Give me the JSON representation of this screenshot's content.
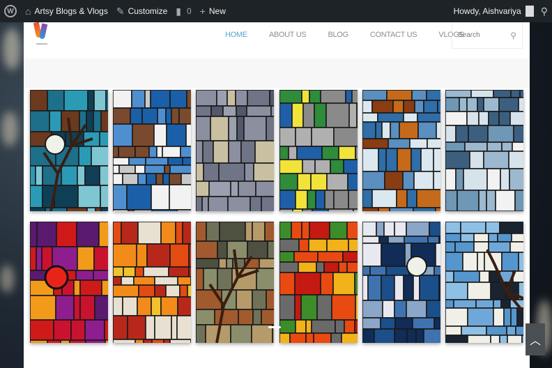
{
  "adminbar": {
    "site_name": "Artsy Blogs & Vlogs",
    "customize_label": "Customize",
    "comments_count": "0",
    "new_label": "New",
    "greeting": "Howdy, Aishvariya"
  },
  "nav": {
    "items": [
      "HOME",
      "ABOUT US",
      "BLOG",
      "CONTACT US",
      "VLOGS"
    ],
    "active": "HOME"
  },
  "search": {
    "placeholder": "Search"
  },
  "gallery": {
    "tiles": [
      {
        "name": "stained-glass-moon-tree-teal",
        "palette": [
          "#1d6f8a",
          "#2a9ab5",
          "#0f3f57",
          "#7fc6d3",
          "#6b3a1e"
        ]
      },
      {
        "name": "stained-glass-blue-white-blocks",
        "palette": [
          "#f2f2f2",
          "#1b5fa8",
          "#c9c9c9",
          "#7a4a2e",
          "#4f8fd0"
        ]
      },
      {
        "name": "stained-glass-grey-grid",
        "palette": [
          "#6f7586",
          "#8b8fa0",
          "#53586a",
          "#9aa0af",
          "#c8c0a0"
        ]
      },
      {
        "name": "stained-glass-green-yellow-blocks",
        "palette": [
          "#8a8a8a",
          "#2e8c3a",
          "#f1e33a",
          "#1f5fa8",
          "#b0b0b0"
        ]
      },
      {
        "name": "stained-glass-amber-rain-blue",
        "palette": [
          "#2f6ea8",
          "#c46a1a",
          "#5a8fc0",
          "#8a3c12",
          "#dbe8f0"
        ]
      },
      {
        "name": "stained-glass-pale-blue-grid",
        "palette": [
          "#d7e3ea",
          "#6f97b6",
          "#f2f2f2",
          "#9cb9cf",
          "#3c5f80"
        ]
      },
      {
        "name": "stained-glass-red-purple-circle",
        "palette": [
          "#d01a1a",
          "#8e1d8e",
          "#f29a1a",
          "#c9122f",
          "#5a1a6e"
        ]
      },
      {
        "name": "stained-glass-birch-autumn",
        "palette": [
          "#e24b12",
          "#f2c12e",
          "#e8e0d0",
          "#b8281a",
          "#f28b1a"
        ]
      },
      {
        "name": "stained-glass-olive-tree",
        "palette": [
          "#8a8e6a",
          "#a15a2e",
          "#6f7258",
          "#b59a6a",
          "#4e5040"
        ]
      },
      {
        "name": "stained-glass-orange-green-blocks",
        "palette": [
          "#e84a12",
          "#3d8c2a",
          "#f2b21a",
          "#c41a12",
          "#6a6a6a"
        ]
      },
      {
        "name": "stained-glass-night-moon-blue",
        "palette": [
          "#102c57",
          "#3f73b0",
          "#e8e8f0",
          "#1b4f8a",
          "#8aa6c8"
        ]
      },
      {
        "name": "stained-glass-sky-branch",
        "palette": [
          "#6fa8d8",
          "#5596cf",
          "#1a2430",
          "#8ec0e6",
          "#f0f0e8"
        ]
      }
    ]
  },
  "scroll_top": {
    "icon": "chevron-up-icon"
  }
}
